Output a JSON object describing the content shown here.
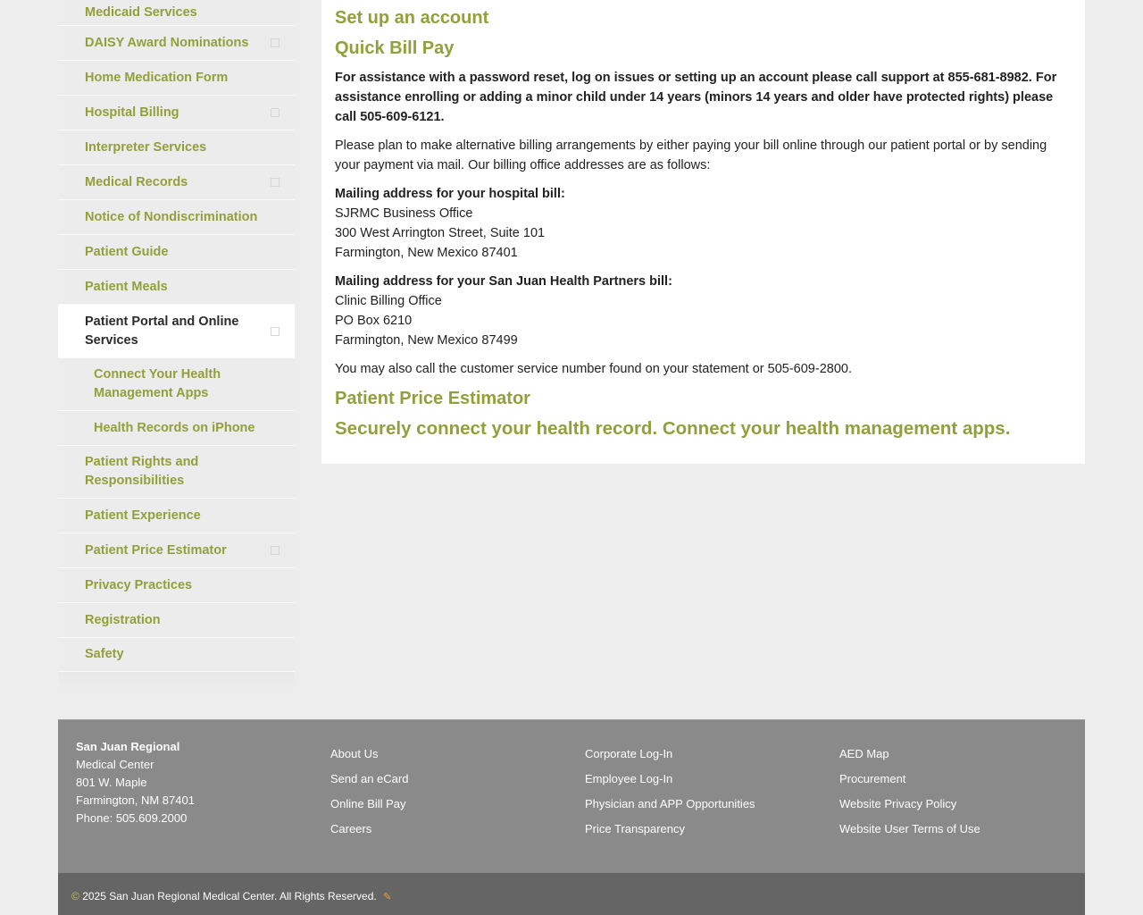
{
  "sidebar": {
    "items": [
      {
        "label": "Medicaid Services",
        "has_toggle": false
      },
      {
        "label": "DAISY Award Nominations",
        "has_toggle": true
      },
      {
        "label": "Home Medication Form",
        "has_toggle": false
      },
      {
        "label": "Hospital Billing",
        "has_toggle": true
      },
      {
        "label": "Interpreter Services",
        "has_toggle": false
      },
      {
        "label": "Medical Records",
        "has_toggle": true
      },
      {
        "label": "Notice of Nondiscrimination",
        "has_toggle": false
      },
      {
        "label": "Patient Guide",
        "has_toggle": false
      },
      {
        "label": "Patient Meals",
        "has_toggle": false
      },
      {
        "label": "Patient Portal and Online Services",
        "has_toggle": true
      },
      {
        "label": "Connect Your Health Management Apps",
        "has_toggle": false
      },
      {
        "label": "Health Records on iPhone",
        "has_toggle": false
      },
      {
        "label": "Patient Rights and Responsibilities",
        "has_toggle": false
      },
      {
        "label": "Patient Experience",
        "has_toggle": false
      },
      {
        "label": "Patient Price Estimator",
        "has_toggle": true
      },
      {
        "label": "Privacy Practices",
        "has_toggle": false
      },
      {
        "label": "Registration",
        "has_toggle": false
      },
      {
        "label": "Safety",
        "has_toggle": false
      }
    ]
  },
  "main": {
    "heading_setup": "Set up an account",
    "heading_quickbill": "Quick Bill Pay",
    "assistance_text": "For assistance with a password reset, log on issues or setting up an account please call support at 855-681-8982. For assistance enrolling or adding a minor child under 14 years (minors 14 years and older have protected rights) please call 505-609-6121.",
    "billing_intro": "Please plan to make alternative billing arrangements by either paying your bill online through our patient portal or by sending your payment via mail. Our billing office addresses are as follows:",
    "hospital_bill": {
      "label": "Mailing address for your hospital bill:",
      "line1": "SJRMC Business Office",
      "line2": "300 West Arrington Street, Suite 101",
      "line3": "Farmington, New Mexico 87401"
    },
    "partners_bill": {
      "label": "Mailing address for your San Juan Health Partners bill:",
      "line1": "Clinic Billing Office",
      "line2": "PO Box 6210",
      "line3": "Farmington, New Mexico 87499"
    },
    "customer_service": "You may also call the customer service number found on your statement or 505-609-2800.",
    "heading_estimator": "Patient Price Estimator",
    "heading_connect": "Securely connect your health record. Connect your health management apps."
  },
  "footer": {
    "org_name": "San Juan Regional",
    "org_line2": "Medical Center",
    "street": "801 W. Maple",
    "city": "Farmington, NM 87401",
    "phone": "Phone: 505.609.2000",
    "col1": [
      "About Us",
      "Send an eCard",
      "Online Bill Pay",
      "Careers"
    ],
    "col2": [
      "Corporate Log-In",
      "Employee Log-In",
      "Physician and APP Opportunities",
      "Price Transparency"
    ],
    "col3": [
      "AED Map",
      "Procurement",
      "Website Privacy Policy",
      "Website User Terms of Use"
    ],
    "copyright_symbol": "©",
    "copyright": "2025 San Juan Regional Medical Center. All Rights Reserved."
  }
}
